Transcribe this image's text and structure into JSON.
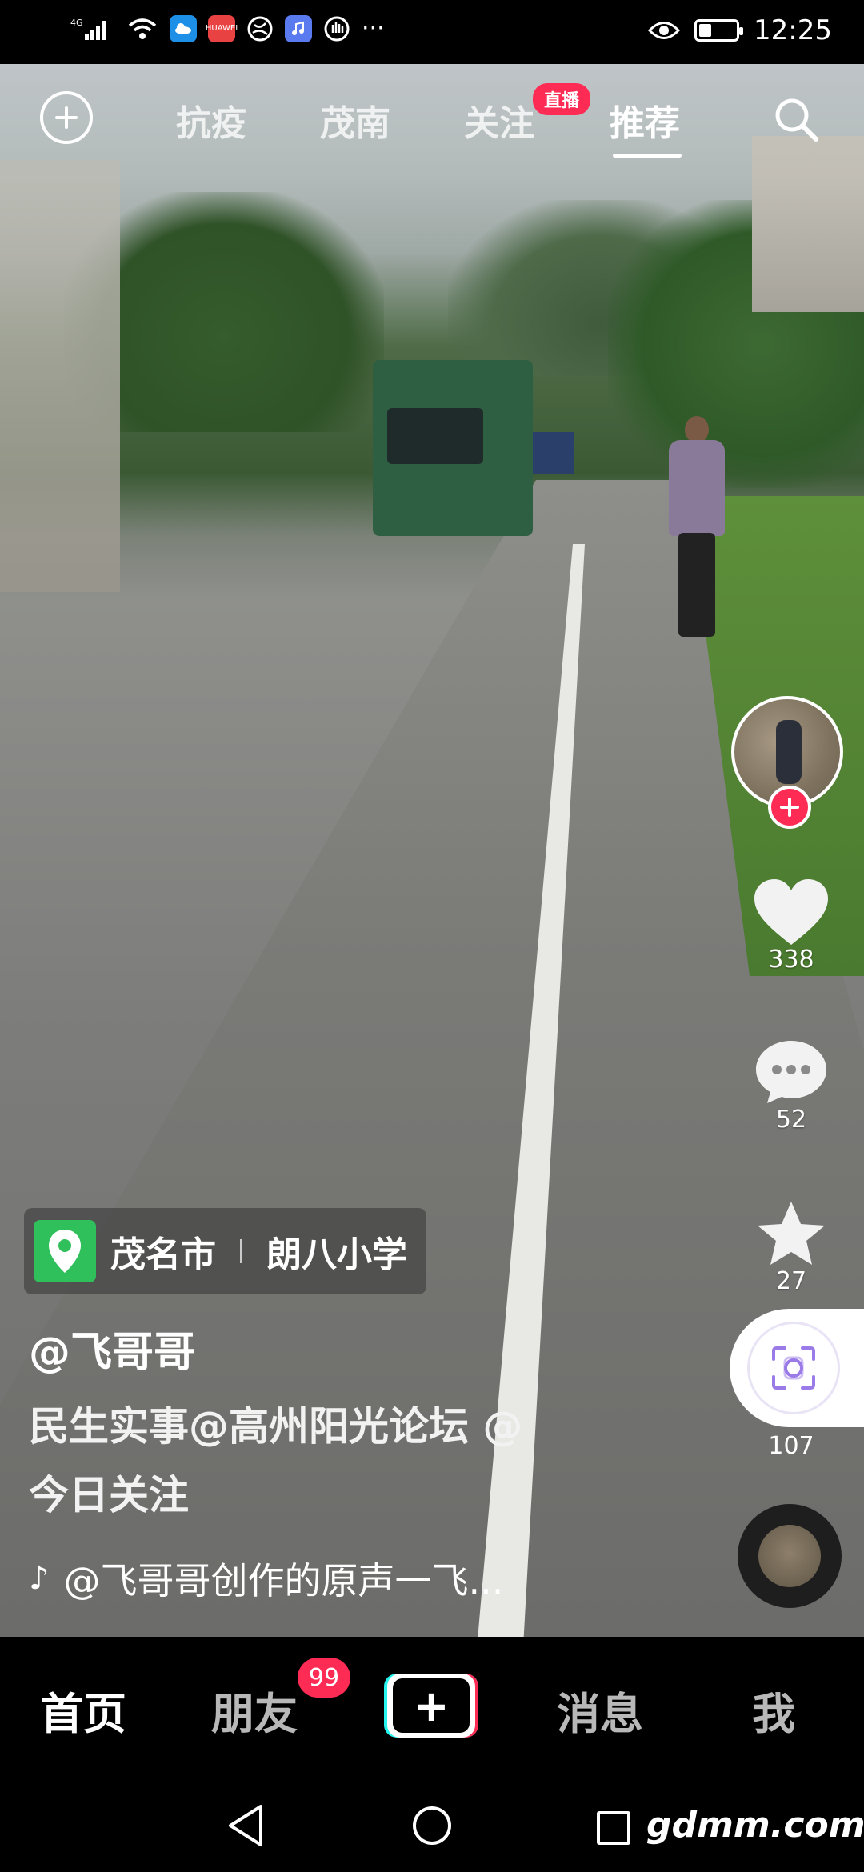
{
  "status_bar": {
    "network": "4G",
    "time": "12:25",
    "battery_level": 0.35,
    "more": "···",
    "app_badge_label": "HUAWEI"
  },
  "top_nav": {
    "tabs": [
      {
        "label": "抗疫"
      },
      {
        "label": "茂南"
      },
      {
        "label": "关注"
      },
      {
        "label": "推荐"
      }
    ],
    "live_badge": "直播",
    "active_tab": "推荐"
  },
  "actions": {
    "likes": "338",
    "comments": "52",
    "favorites": "27",
    "shares": "107"
  },
  "location": {
    "city": "茂名市",
    "place": "朗八小学"
  },
  "post": {
    "author": "@飞哥哥",
    "caption_line1": "民生实事@高州阳光论坛 @",
    "caption_line2": "今日关注",
    "music": "@飞哥哥创作的原声一飞..."
  },
  "bottom_nav": {
    "home": "首页",
    "friends": "朋友",
    "friends_badge": "99",
    "messages": "消息",
    "me": "我"
  },
  "watermark": "gdmm.com",
  "colors": {
    "accent": "#fe2c55",
    "location_green": "#2fbf5b"
  }
}
